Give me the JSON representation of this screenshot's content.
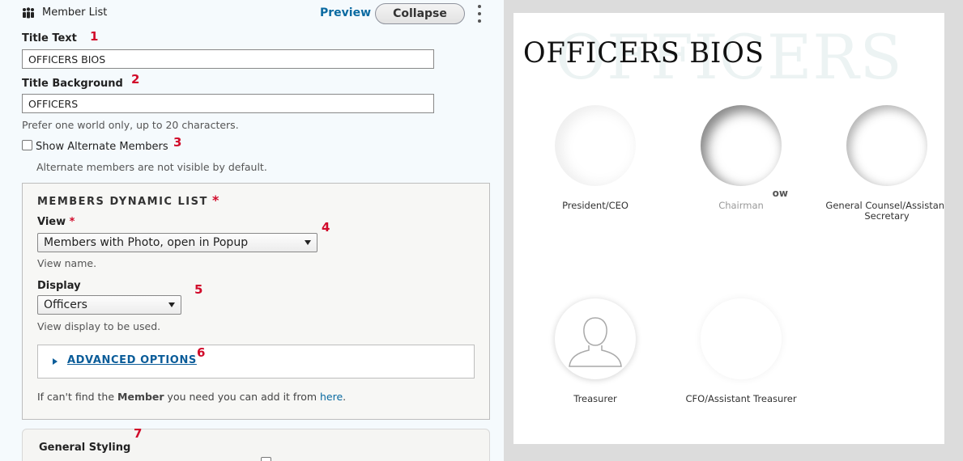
{
  "header": {
    "icon": "people-group-icon",
    "title": "Member List",
    "preview_label": "Preview",
    "collapse_label": "Collapse"
  },
  "fields": {
    "title_text": {
      "label": "Title Text",
      "value": "OFFICERS BIOS",
      "marker": "1"
    },
    "title_background": {
      "label": "Title Background",
      "value": "OFFICERS",
      "marker": "2",
      "description": "Prefer one world only, up to 20 characters."
    },
    "show_alternate": {
      "label": "Show Alternate Members",
      "checked": false,
      "marker": "3",
      "description": "Alternate members are not visible by default."
    }
  },
  "dynamic_list": {
    "legend": "MEMBERS DYNAMIC LIST",
    "required_mark": "*",
    "view": {
      "label": "View",
      "required_mark": "*",
      "selected": "Members with Photo, open in Popup",
      "description": "View name.",
      "marker": "4"
    },
    "display": {
      "label": "Display",
      "selected": "Officers",
      "description": "View display to be used.",
      "marker": "5"
    },
    "advanced": {
      "label": "ADVANCED OPTIONS",
      "marker": "6"
    },
    "help": {
      "prefix": "If can't find the ",
      "bold": "Member",
      "middle": " you need you can add it from ",
      "link": "here",
      "suffix": "."
    }
  },
  "general_styling": {
    "label": "General Styling",
    "marker": "7"
  },
  "preview": {
    "background_title": "OFFICERS",
    "title": "OFFICERS BIOS",
    "officers": [
      {
        "name": "",
        "role": "President/CEO",
        "photo": "blurred"
      },
      {
        "name": "ow",
        "role": "Chairman",
        "photo": "blurred"
      },
      {
        "name": "",
        "role": "General Counsel/Assistant Secretary",
        "photo": "blurred"
      },
      {
        "name": "",
        "role": "Treasurer",
        "photo": "placeholder-person-icon"
      },
      {
        "name": "",
        "role": "CFO/Assistant Treasurer",
        "photo": "blurred"
      }
    ]
  }
}
